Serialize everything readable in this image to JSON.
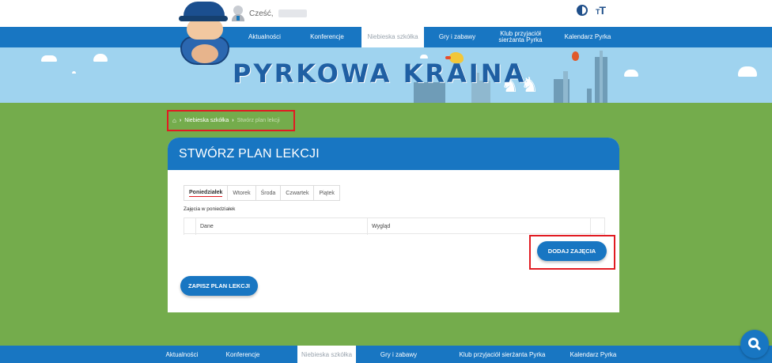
{
  "header": {
    "greeting": "Cześć,",
    "contrast_icon": "contrast-icon",
    "font_size_icon": "font-size-icon"
  },
  "nav": {
    "items": [
      {
        "label": "Aktualności",
        "active": false
      },
      {
        "label": "Konferencje",
        "active": false
      },
      {
        "label": "Niebieska szkółka",
        "active": true
      },
      {
        "label": "Gry i zabawy",
        "active": false
      },
      {
        "label": "Klub przyjaciół sierżanta Pyrka",
        "active": false
      },
      {
        "label": "Kalendarz Pyrka",
        "active": false
      }
    ]
  },
  "banner": {
    "title": "PYRKOWA KRAINA"
  },
  "breadcrumb": {
    "home_icon": "home-icon",
    "level1": "Niebieska szkółka",
    "level2": "Stwórz plan lekcji"
  },
  "card": {
    "title": "STWÓRZ PLAN LEKCJI",
    "tabs": [
      "Poniedziałek",
      "Wtorek",
      "Środa",
      "Czwartek",
      "Piątek"
    ],
    "active_tab": "Poniedziałek",
    "section_label": "Zajęcia w poniedziałek",
    "table_headers": [
      "Dane",
      "Wygląd"
    ],
    "add_button": "DODAJ ZAJĘCIA",
    "save_button": "ZAPISZ PLAN LEKCJI"
  },
  "footer_nav": {
    "items": [
      {
        "label": "Aktualności",
        "active": false
      },
      {
        "label": "Konferencje",
        "active": false
      },
      {
        "label": "Niebieska szkółka",
        "active": true
      },
      {
        "label": "Gry i zabawy",
        "active": false
      },
      {
        "label": "Klub przyjaciół sierżanta Pyrka",
        "active": false
      },
      {
        "label": "Kalendarz Pyrka",
        "active": false
      }
    ]
  },
  "colors": {
    "primary_blue": "#1876c2",
    "grass_green": "#74ac4c",
    "sky_blue": "#9fd3ef",
    "highlight_red": "#e11b22"
  },
  "search_icon": "search-icon"
}
